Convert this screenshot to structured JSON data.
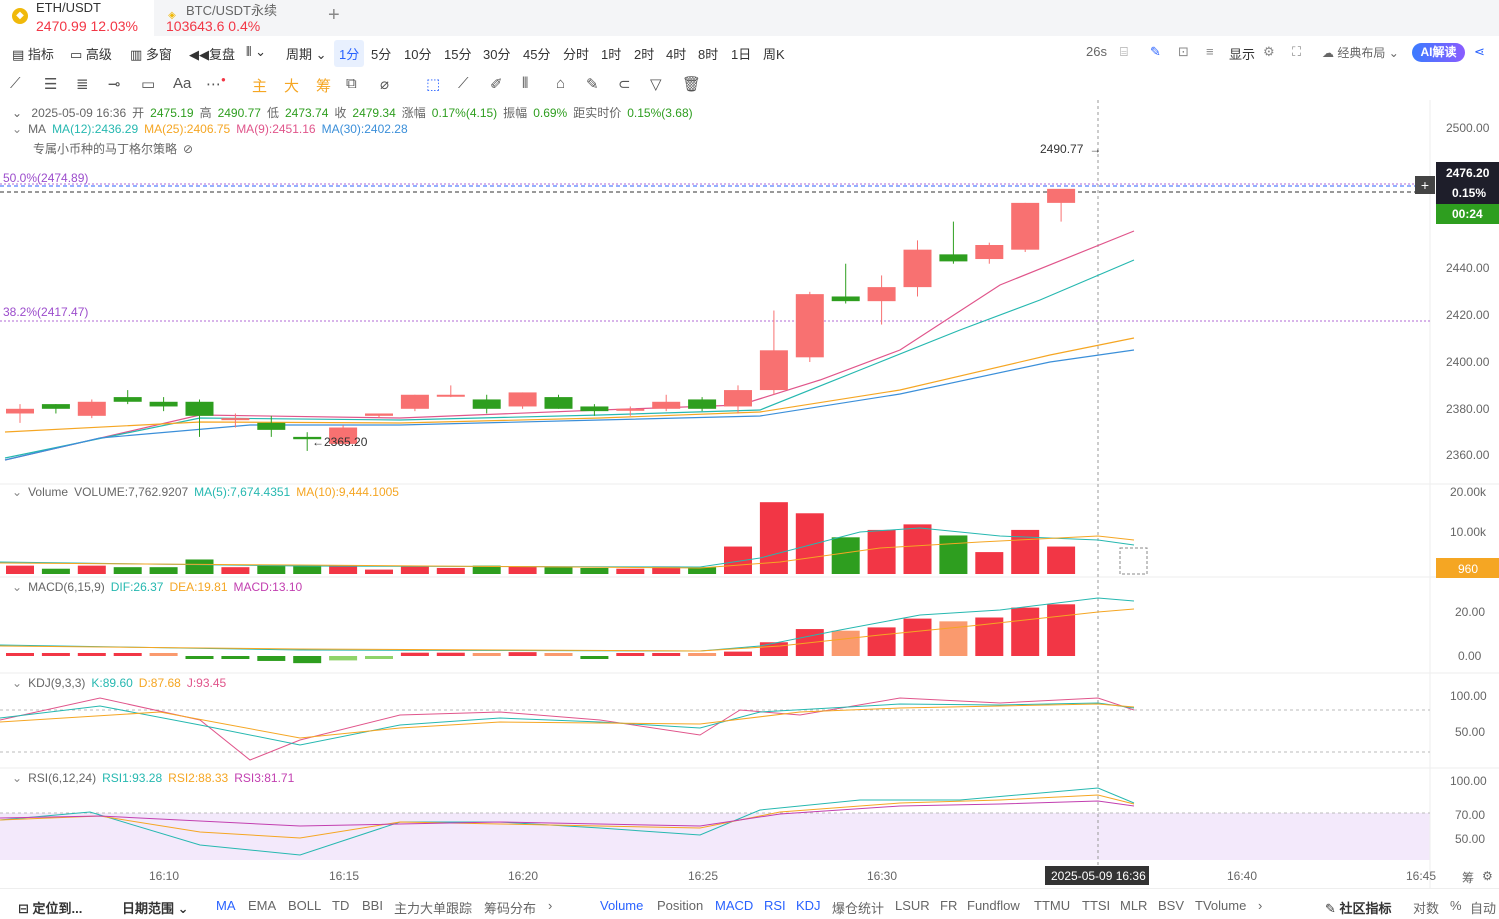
{
  "tabs": [
    {
      "name": "ETH/USDT",
      "price": "2470.99  12.03%"
    },
    {
      "name": "BTC/USDT永续",
      "price": "103643.6  0.4%"
    }
  ],
  "toolbar": {
    "items": [
      "指标",
      "高级",
      "多窗",
      "复盘",
      "周期",
      "1分",
      "5分",
      "10分",
      "15分",
      "30分",
      "45分",
      "分时",
      "1时",
      "2时",
      "4时",
      "8时",
      "1日",
      "周K"
    ],
    "countdown": "26s",
    "display": "显示",
    "layout": "经典布局",
    "ai": "AI解读"
  },
  "drawtools": [
    "主",
    "大",
    "筹"
  ],
  "font_tool": "Aa",
  "ohlc": {
    "date": "2025-05-09 16:36",
    "open_l": "开",
    "open": "2475.19",
    "high_l": "高",
    "high": "2490.77",
    "low_l": "低",
    "low": "2473.74",
    "close_l": "收",
    "close": "2479.34",
    "chg_l": "涨幅",
    "chg": "0.17%(4.15)",
    "amp_l": "振幅",
    "amp": "0.69%",
    "dist_l": "距实时价",
    "dist": "0.15%(3.68)"
  },
  "ma": {
    "label": "MA",
    "ma12": "MA(12):2436.29",
    "ma25": "MA(25):2406.75",
    "ma9": "MA(9):2451.16",
    "ma30": "MA(30):2402.28"
  },
  "strategy": "专属小币种的马丁格尔策略",
  "fib": {
    "f50": "50.0%(2474.89)",
    "f38": "38.2%(2417.47)"
  },
  "annotations": {
    "high": "2490.77",
    "low": "2365.20"
  },
  "price_axis": [
    "2500.00",
    "2440.00",
    "2420.00",
    "2400.00",
    "2380.00",
    "2360.00"
  ],
  "price_tag": {
    "price": "2476.20",
    "pct": "0.15%",
    "timer": "00:24"
  },
  "volume": {
    "label": "Volume",
    "v": "VOLUME:7,762.9207",
    "ma5": "MA(5):7,674.4351",
    "ma10": "MA(10):9,444.1005",
    "axis": [
      "20.00k",
      "10.00k"
    ],
    "tag": "960"
  },
  "macd": {
    "label": "MACD(6,15,9)",
    "dif": "DIF:26.37",
    "dea": "DEA:19.81",
    "macd": "MACD:13.10",
    "axis": [
      "20.00",
      "0.00"
    ]
  },
  "kdj": {
    "label": "KDJ(9,3,3)",
    "k": "K:89.60",
    "d": "D:87.68",
    "j": "J:93.45",
    "axis": [
      "100.00",
      "50.00"
    ]
  },
  "rsi": {
    "label": "RSI(6,12,24)",
    "r1": "RSI1:93.28",
    "r2": "RSI2:88.33",
    "r3": "RSI3:81.71",
    "axis": [
      "100.00",
      "70.00",
      "50.00"
    ]
  },
  "time_axis": [
    "16:10",
    "16:15",
    "16:20",
    "16:25",
    "16:30",
    "16:40",
    "16:45"
  ],
  "crosshair_time": "2025-05-09 16:36",
  "bottom": {
    "locate": "定位到...",
    "range": "日期范围",
    "main": [
      "MA",
      "EMA",
      "BOLL",
      "TD",
      "BBI",
      "主力大单跟踪",
      "筹码分布"
    ],
    "sub": [
      "Volume",
      "Position",
      "MACD",
      "RSI",
      "KDJ",
      "爆仓统计",
      "LSUR",
      "FR",
      "Fundflow",
      "TTMU",
      "TTSI",
      "MLR",
      "BSV",
      "TVolume"
    ],
    "right": [
      "社区指标",
      "对数",
      "%",
      "自动"
    ],
    "chip": "筹"
  },
  "colors": {
    "up": "#f23645",
    "down": "#2e9e1f",
    "accent": "#2962ff"
  },
  "chart_data": {
    "type": "candlestick",
    "x": [
      "16:08",
      "16:09",
      "16:10",
      "16:11",
      "16:12",
      "16:13",
      "16:14",
      "16:15",
      "16:16",
      "16:17",
      "16:18",
      "16:19",
      "16:20",
      "16:21",
      "16:22",
      "16:23",
      "16:24",
      "16:25",
      "16:26",
      "16:27",
      "16:28",
      "16:29",
      "16:30",
      "16:31",
      "16:32",
      "16:33",
      "16:34",
      "16:35",
      "16:36",
      "16:37"
    ],
    "candles": [
      [
        2378,
        2382,
        2374,
        2380
      ],
      [
        2382,
        2382,
        2378,
        2380
      ],
      [
        2377,
        2384,
        2376,
        2383
      ],
      [
        2385,
        2388,
        2382,
        2383
      ],
      [
        2383,
        2385,
        2379,
        2381
      ],
      [
        2383,
        2384,
        2368,
        2377
      ],
      [
        2376,
        2378,
        2372,
        2376
      ],
      [
        2374,
        2377,
        2368,
        2371
      ],
      [
        2368,
        2370,
        2362,
        2367
      ],
      [
        2365,
        2373,
        2365,
        2372
      ],
      [
        2377,
        2378,
        2376,
        2378
      ],
      [
        2380,
        2386,
        2379,
        2386
      ],
      [
        2386,
        2390,
        2385,
        2386
      ],
      [
        2384,
        2386,
        2378,
        2380
      ],
      [
        2381,
        2387,
        2380,
        2387
      ],
      [
        2385,
        2386,
        2380,
        2380
      ],
      [
        2381,
        2382,
        2377,
        2379
      ],
      [
        2380,
        2381,
        2377,
        2380
      ],
      [
        2380,
        2386,
        2379,
        2383
      ],
      [
        2384,
        2385,
        2379,
        2380
      ],
      [
        2381,
        2390,
        2378,
        2388
      ],
      [
        2388,
        2422,
        2386,
        2405
      ],
      [
        2402,
        2430,
        2400,
        2429
      ],
      [
        2428,
        2442,
        2425,
        2426
      ],
      [
        2426,
        2437,
        2416,
        2432
      ],
      [
        2432,
        2452,
        2428,
        2448
      ],
      [
        2446,
        2460,
        2442,
        2443
      ],
      [
        2444,
        2451,
        2442,
        2450
      ],
      [
        2448,
        2468,
        2447,
        2468
      ],
      [
        2468,
        2472,
        2460,
        2474
      ]
    ]
  }
}
